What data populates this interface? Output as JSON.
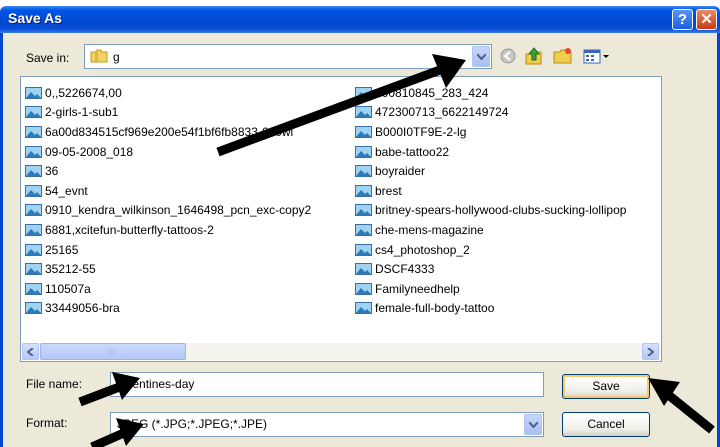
{
  "dialog": {
    "title": "Save As",
    "help_label": "?",
    "close_label": "✕"
  },
  "save_in": {
    "label": "Save in:",
    "value": "g"
  },
  "toolbar": {
    "icons": [
      "back-icon",
      "up-folder-icon",
      "new-folder-icon",
      "views-menu-icon"
    ]
  },
  "files": {
    "left": [
      "0,,5226674,00",
      "2-girls-1-sub1",
      "6a00d834515cf969e200e54f1bf6fb8833-640wi",
      "09-05-2008_018",
      "36",
      "54_evnt",
      "0910_kendra_wilkinson_1646498_pcn_exc-copy2",
      "6881,xcitefun-butterfly-tattoos-2",
      "25165",
      "35212-55",
      "110507a",
      "33449056-bra"
    ],
    "right": [
      "200810845_283_424",
      "472300713_6622149724",
      "B000I0TF9E-2-lg",
      "babe-tattoo22",
      "boyraider",
      "brest",
      "britney-spears-hollywood-clubs-sucking-lollipop",
      "che-mens-magazine",
      "cs4_photoshop_2",
      "DSCF4333",
      "Familyneedhelp",
      "female-full-body-tattoo"
    ]
  },
  "file_name": {
    "label": "File name:",
    "value": "valentines-day"
  },
  "format": {
    "label": "Format:",
    "value": "JPEG (*.JPG;*.JPEG;*.JPE)"
  },
  "buttons": {
    "save": "Save",
    "cancel": "Cancel"
  },
  "colors": {
    "titlebar": "#0047d0",
    "dialog_bg": "#ece9d8",
    "annotation_arrow": "#000000"
  }
}
